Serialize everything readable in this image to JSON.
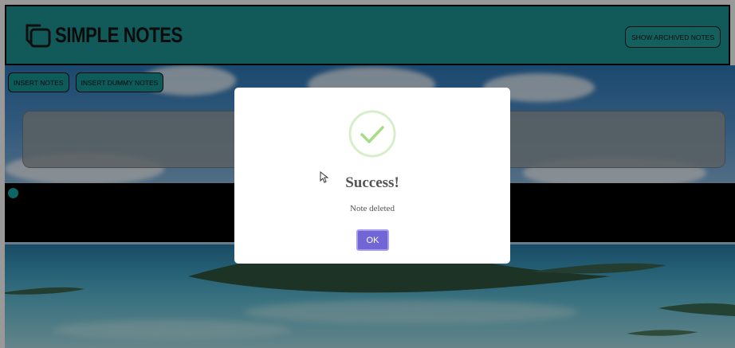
{
  "app": {
    "title": "SIMPLE NOTES"
  },
  "header": {
    "archived_button": "SHOW ARCHIVED NOTES"
  },
  "toolbar": {
    "insert_notes": "INSERT NOTES",
    "insert_dummy_notes": "INSERT DUMMY NOTES"
  },
  "dialog": {
    "title": "Success!",
    "message": "Note deleted",
    "ok_label": "OK",
    "icon": "success-check-icon"
  },
  "colors": {
    "header": "#1d9795",
    "button": "#169896",
    "confirm": "#7166d6",
    "success": "#a5dc86"
  }
}
